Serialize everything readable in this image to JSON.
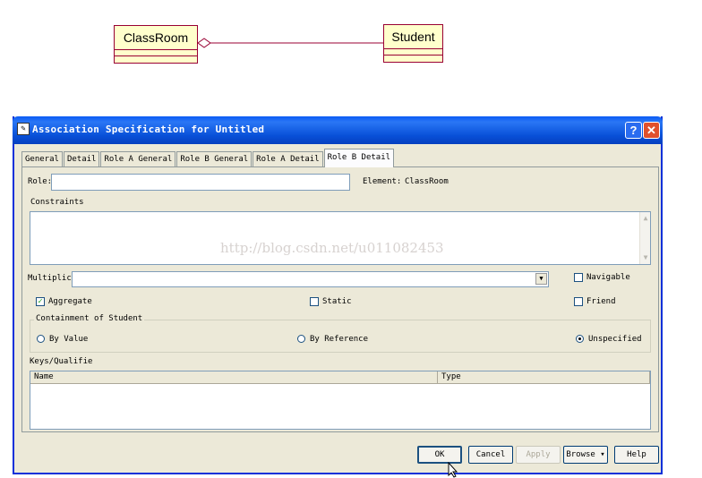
{
  "uml": {
    "class_left": "ClassRoom",
    "class_right": "Student"
  },
  "dialog": {
    "title": "Association Specification for Untitled",
    "help_button": "?",
    "close_button": "✕",
    "tabs": [
      "General",
      "Detail",
      "Role A General",
      "Role B General",
      "Role A Detail",
      "Role B Detail"
    ],
    "active_tab": "Role B Detail",
    "role_label": "Role:",
    "role_value": "",
    "element_label": "Element:",
    "element_value": "ClassRoom",
    "constraints_label": "Constraints",
    "constraints_value": "",
    "watermark": "http://blog.csdn.net/u011082453",
    "multiplicity_label": "Multiplic",
    "multiplicity_value": "",
    "navigable_label": "Navigable",
    "navigable_checked": false,
    "aggregate_label": "Aggregate",
    "aggregate_checked": true,
    "static_label": "Static",
    "static_checked": false,
    "friend_label": "Friend",
    "friend_checked": false,
    "containment_legend": "Containment of Student",
    "containment_options": [
      "By Value",
      "By Reference",
      "Unspecified"
    ],
    "containment_selected": "Unspecified",
    "keys_label": "Keys/Qualifie",
    "keys_columns": [
      "Name",
      "Type"
    ],
    "buttons": {
      "ok": "OK",
      "cancel": "Cancel",
      "apply": "Apply",
      "browse": "Browse ▾",
      "help": "Help"
    }
  }
}
